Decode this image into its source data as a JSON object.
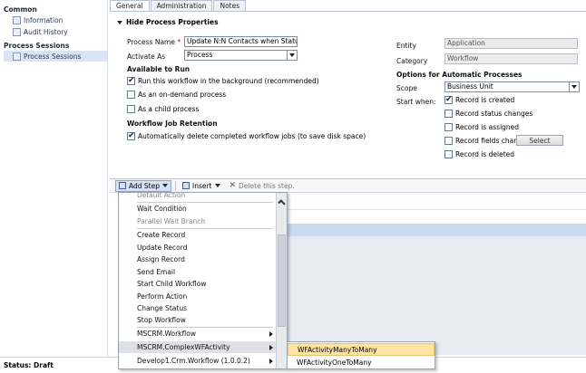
{
  "nav": {
    "groups": [
      {
        "title": "Common",
        "items": [
          "Information",
          "Audit History"
        ]
      },
      {
        "title": "Process Sessions",
        "items": [
          "Process Sessions"
        ]
      }
    ]
  },
  "tabs": [
    "General",
    "Administration",
    "Notes"
  ],
  "props": {
    "section_title": "Hide Process Properties",
    "process_name_label": "Process Name",
    "required_mark": "*",
    "process_name_value": "Update N:N Contacts when Status Chan",
    "activate_as_label": "Activate As",
    "activate_as_value": "Process",
    "available_to_run": "Available to Run",
    "run_background": "Run this workflow in the background (recommended)",
    "on_demand": "As an on-demand process",
    "child_process": "As a child process",
    "retention_title": "Workflow Job Retention",
    "auto_delete": "Automatically delete completed workflow jobs (to save disk space)",
    "entity_label": "Entity",
    "entity_value": "Application",
    "category_label": "Category",
    "category_value": "Workflow",
    "options_title": "Options for Automatic Processes",
    "scope_label": "Scope",
    "scope_value": "Business Unit",
    "start_when_label": "Start when:",
    "record_created": "Record is created",
    "status_changes": "Record status changes",
    "record_assigned": "Record is assigned",
    "fields_change": "Record fields change",
    "select_button": "Select",
    "record_deleted": "Record is deleted"
  },
  "toolbar": {
    "add_step": "Add Step",
    "insert": "Insert",
    "delete": "Delete this step."
  },
  "menu": {
    "items": [
      "Default Action",
      "Wait Condition",
      "Parallel Wait Branch",
      "Create Record",
      "Update Record",
      "Assign Record",
      "Send Email",
      "Start Child Workflow",
      "Perform Action",
      "Change Status",
      "Stop Workflow",
      "MSCRM.Workflow",
      "MSCRM.ComplexWFActivity",
      "Develop1.Crm.Workflow (1.0.0.2)"
    ]
  },
  "submenu": {
    "items": [
      "WFActivityManyToMany",
      "WFActivityOneToMany"
    ]
  },
  "status": "Status: Draft"
}
